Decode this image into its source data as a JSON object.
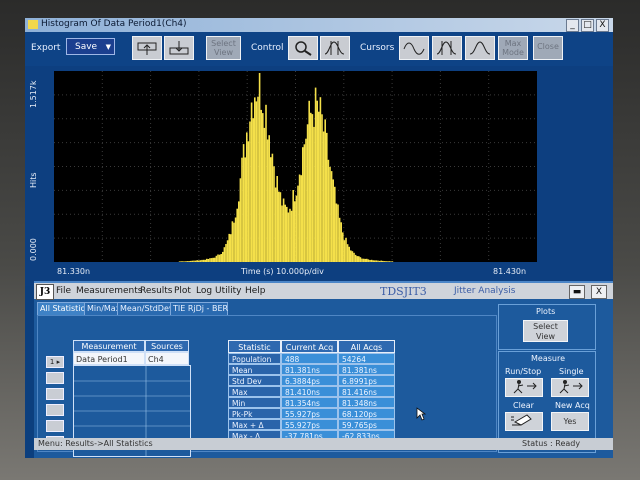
{
  "window": {
    "title": "Histogram Of Data Period1(Ch4)",
    "buttons": [
      "_",
      "□",
      "X"
    ]
  },
  "toolbar": {
    "export_label": "Export",
    "export_value": "Save",
    "select_view": "Select View",
    "control_label": "Control",
    "cursors_label": "Cursors",
    "max_mode": "Max Mode",
    "close": "Close"
  },
  "histogram": {
    "y_label": "Hits",
    "y_top": "1.517k",
    "y_bottom": "0.000",
    "x_left": "81.330n",
    "x_right": "81.430n",
    "x_label": "Time (s)  10.000p/div",
    "trace_color": "#f4e04a",
    "peaks_ns": [
      81.372,
      81.384
    ]
  },
  "app": {
    "logo": "J3",
    "menus": [
      "File",
      "Measurements",
      "Results",
      "Plot",
      "Log",
      "Utility",
      "Help"
    ],
    "title": "TDSJIT3",
    "subtitle": "Jitter Analysis",
    "window_buttons": [
      "▬",
      "X"
    ]
  },
  "tabs": [
    "All Statistics",
    "Min/Max",
    "Mean/StdDev",
    "TIE RjDj - BER"
  ],
  "measurements": {
    "headers": [
      "Measurement",
      "Sources"
    ],
    "row": {
      "name": "Data Period1",
      "source": "Ch4",
      "index": "1 ▸"
    }
  },
  "stats": {
    "headers": [
      "Statistic",
      "Current Acq",
      "All Acqs"
    ],
    "rows": [
      [
        "Population",
        "488",
        "54264"
      ],
      [
        "Mean",
        "81.381ns",
        "81.381ns"
      ],
      [
        "Std Dev",
        "6.3884ps",
        "6.8991ps"
      ],
      [
        "Max",
        "81.410ns",
        "81.416ns"
      ],
      [
        "Min",
        "81.354ns",
        "81.348ns"
      ],
      [
        "Pk-Pk",
        "55.927ps",
        "68.120ps"
      ],
      [
        "Max + Δ",
        "55.927ps",
        "59.765ps"
      ],
      [
        "Max - Δ",
        "-37.781ps",
        "-62.833ps"
      ]
    ]
  },
  "plots_panel": {
    "title": "Plots",
    "select_view": "Select View"
  },
  "measure_panel": {
    "title": "Measure",
    "run_stop": "Run/Stop",
    "single": "Single",
    "clear": "Clear",
    "new_acq": "New Acq",
    "yes": "Yes"
  },
  "status": {
    "left": "Menu: Results->All Statistics",
    "right": "Status : Ready"
  }
}
